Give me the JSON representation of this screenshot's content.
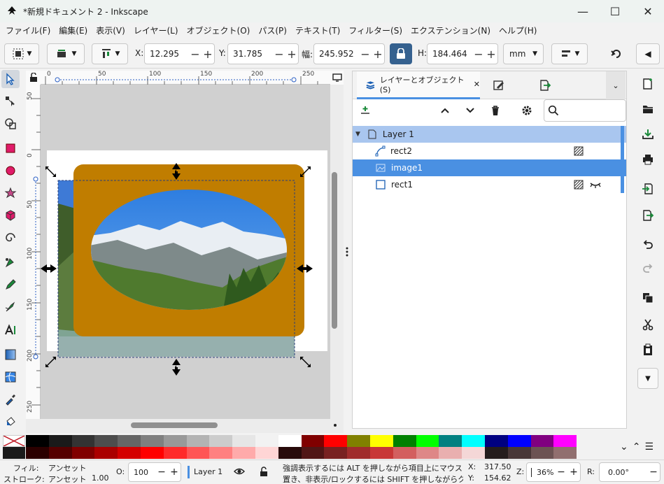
{
  "window": {
    "title": "*新規ドキュメント 2 - Inkscape",
    "minimize_glyph": "—",
    "maximize_glyph": "☐",
    "close_glyph": "✕"
  },
  "menu": [
    "ファイル(F)",
    "編集(E)",
    "表示(V)",
    "レイヤー(L)",
    "オブジェクト(O)",
    "パス(P)",
    "テキスト(T)",
    "フィルター(S)",
    "エクステンション(N)",
    "ヘルプ(H)"
  ],
  "toolbar": {
    "x_label": "X:",
    "x_value": "12.295",
    "y_label": "Y:",
    "y_value": "31.785",
    "w_label": "幅:",
    "w_value": "245.952",
    "h_label": "H:",
    "h_value": "184.464",
    "unit": "mm",
    "minus": "−",
    "plus": "+"
  },
  "rulers": {
    "h_ticks": [
      "0",
      "50",
      "100",
      "150",
      "200",
      "250"
    ],
    "v_ticks": [
      "50",
      "0",
      "50",
      "100",
      "150",
      "200",
      "250"
    ]
  },
  "panel": {
    "tab_label": "レイヤーとオブジェクト(S)",
    "tab_close": "✕",
    "rows": [
      {
        "name": "Layer 1",
        "kind": "layer"
      },
      {
        "name": "rect2",
        "kind": "path"
      },
      {
        "name": "image1",
        "kind": "image"
      },
      {
        "name": "rect1",
        "kind": "rect"
      }
    ]
  },
  "status": {
    "fill_label": "フィル:",
    "fill_value": "アンセット",
    "stroke_label": "ストローク:",
    "stroke_value": "アンセット",
    "stroke_width": "1.00",
    "opacity_label": "O:",
    "opacity_value": "100",
    "layer_name": "Layer 1",
    "message_line1": "強調表示するには ALT を押しながら項目上にマウスを",
    "message_line2": "置き、非表示/ロックするには SHIFT を押しながらクリ...",
    "x_label": "X:",
    "x_value": "317.50",
    "y_label": "Y:",
    "y_value": "154.62",
    "zoom_label": "Z:",
    "zoom_value": "36%",
    "rotate_label": "R:",
    "rotate_value": "0.00°"
  },
  "colors": {
    "accent": "#4a90e2",
    "layer_row": "#a9c6ef",
    "selected_row": "#4a90e2",
    "shape_fill": "#c07d00",
    "lock_blue": "#35618f"
  },
  "palette": {
    "row1": [
      "#000000",
      "#1a1a1a",
      "#333333",
      "#4d4d4d",
      "#666666",
      "#808080",
      "#999999",
      "#b3b3b3",
      "#cccccc",
      "#e6e6e6",
      "#f2f2f2",
      "#ffffff",
      "#800000",
      "#ff0000",
      "#808000",
      "#ffff00",
      "#008000",
      "#00ff00",
      "#008080",
      "#00ffff",
      "#000080",
      "#0000ff",
      "#800080",
      "#ff00ff"
    ],
    "row2": [
      "#2b0000",
      "#550000",
      "#800000",
      "#aa0000",
      "#d40000",
      "#ff0000",
      "#ff2a2a",
      "#ff5555",
      "#ff8080",
      "#ffaaaa",
      "#ffd5d5",
      "#280b0b",
      "#501616",
      "#782121",
      "#a02c2c",
      "#c83737",
      "#d35f5f",
      "#de8787",
      "#e9afaf",
      "#f4d7d7",
      "#241c1c",
      "#483737",
      "#6c5353",
      "#916f6f"
    ]
  }
}
